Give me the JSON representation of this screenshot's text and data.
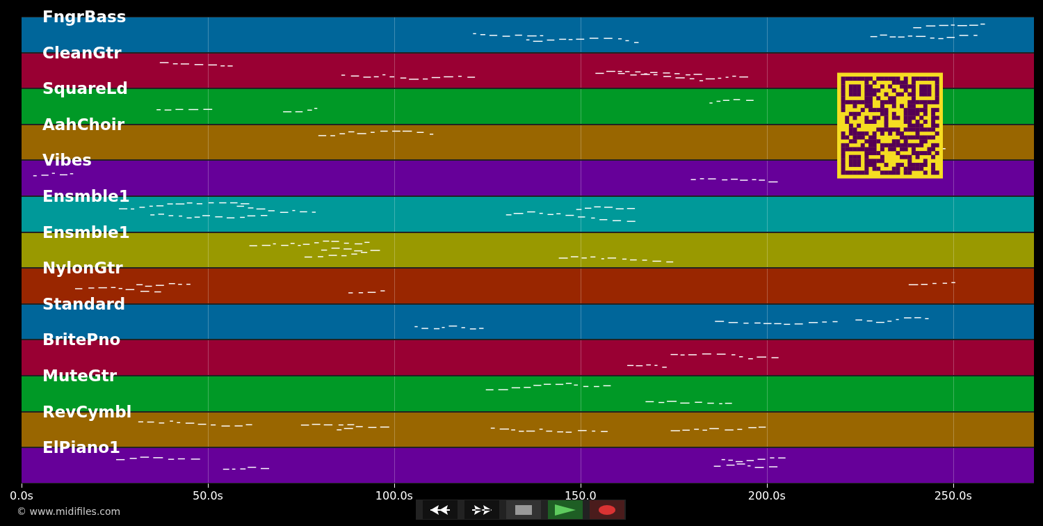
{
  "tracks": [
    {
      "name": "FngrBass",
      "color": "#00669a"
    },
    {
      "name": "CleanGtr",
      "color": "#990033"
    },
    {
      "name": "SquareLd",
      "color": "#009926"
    },
    {
      "name": "AahChoir",
      "color": "#996600"
    },
    {
      "name": "Vibes",
      "color": "#660099"
    },
    {
      "name": "Ensmble1",
      "color": "#009999"
    },
    {
      "name": "Ensmble1",
      "color": "#999900"
    },
    {
      "name": "NylonGtr",
      "color": "#992600"
    },
    {
      "name": "Standard",
      "color": "#00669a"
    },
    {
      "name": "BritePno",
      "color": "#990033"
    },
    {
      "name": "MuteGtr",
      "color": "#009926"
    },
    {
      "name": "RevCymbl",
      "color": "#996600"
    },
    {
      "name": "ElPiano1",
      "color": "#660099"
    }
  ],
  "axis": {
    "ticks": [
      "0.0s",
      "50.0s",
      "100.0s",
      "150.0",
      "200.0s",
      "250.0s"
    ]
  },
  "copyright": "© www.midifiles.com"
}
